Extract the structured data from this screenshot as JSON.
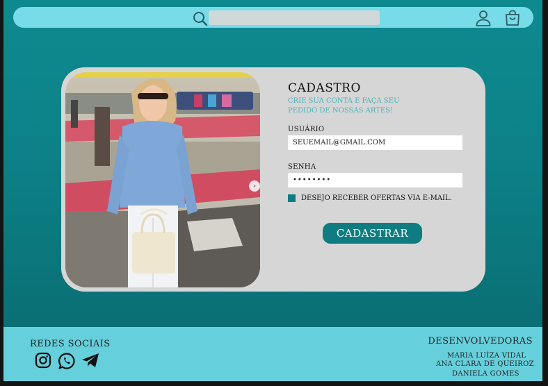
{
  "header": {
    "search_placeholder": "",
    "icons": [
      "search-icon",
      "user-icon",
      "shopping-bag-icon"
    ]
  },
  "signup": {
    "title": "CADASTRO",
    "subtitle": "CRIE SUA CONTA E FAÇA SEU PEDIDO DE NOSSAS ARTES!",
    "user_label": "USUÁRIO",
    "user_value": "SEUEMAIL@GMAIL.COM",
    "password_label": "SENHA",
    "password_value": "••••••••",
    "checkbox_label": "DESEJO RECEBER OFERTAS VIA E-MAIL.",
    "checkbox_checked": true,
    "submit_label": "CADASTRAR"
  },
  "carousel": {
    "next_glyph": "›"
  },
  "footer": {
    "social_title": "REDES SOCIAIS",
    "social_icons": [
      "instagram-icon",
      "whatsapp-icon",
      "telegram-icon"
    ],
    "devs_title": "DESENVOLVEDORAS",
    "devs": [
      "MARIA LUÍZA VIDAL",
      "ANA CLARA DE QUEIROZ",
      "DANIELA GOMES"
    ]
  },
  "colors": {
    "background": "#0c8288",
    "topbar": "#77dbe8",
    "card": "#d6d6d6",
    "accent": "#0f7c82",
    "subtitle": "#4ab3bb",
    "footer": "#66cfdc"
  }
}
